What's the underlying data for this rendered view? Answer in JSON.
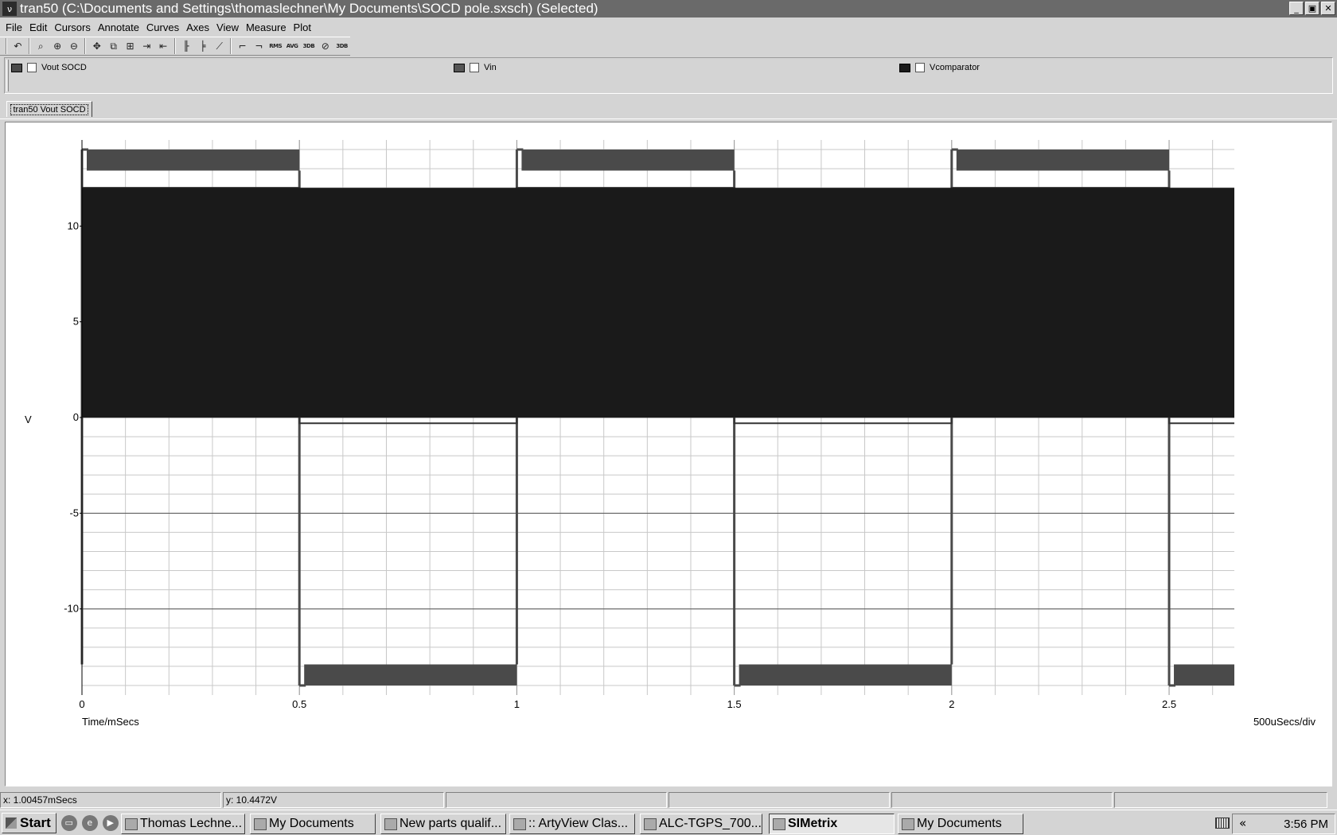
{
  "window": {
    "title": "tran50 (C:\\Documents and Settings\\thomaslechner\\My Documents\\SOCD pole.sxsch) (Selected)",
    "app_icon": "simetrix-icon",
    "minimize": "_",
    "maximize": "▣",
    "close": "✕"
  },
  "menu": [
    "File",
    "Edit",
    "Cursors",
    "Annotate",
    "Curves",
    "Axes",
    "View",
    "Measure",
    "Plot"
  ],
  "toolbar": {
    "groups": [
      [
        "undo-icon"
      ],
      [
        "zoom-full-icon",
        "zoom-in-icon",
        "zoom-out-icon"
      ],
      [
        "pan-icon",
        "zoom-box-icon",
        "abs-icon",
        "cursor-add-icon",
        "cursor-del-icon"
      ],
      [
        "new-grid-icon",
        "stack-grid-icon",
        "log-axis-icon"
      ],
      [
        "rise-icon",
        "fall-icon",
        "rms-icon",
        "avg-icon",
        "3db-high-icon",
        "3db-low-icon",
        "3db-band-icon"
      ]
    ],
    "labels": {
      "rms": "RMS",
      "avg": "AVG",
      "db1": "3DB",
      "db2": "3DB"
    }
  },
  "legend": [
    {
      "name": "Vout SOCD",
      "color": "#4a4a4a"
    },
    {
      "name": "Vin",
      "color": "#555555"
    },
    {
      "name": "Vcomparator",
      "color": "#1a1a1a"
    }
  ],
  "tab": {
    "label": "tran50 Vout SOCD"
  },
  "chart_data": {
    "type": "line",
    "xlabel": "Time/mSecs",
    "ylabel": "V",
    "x_scale_label": "500uSecs/div",
    "xlim": [
      0,
      2.65
    ],
    "ylim": [
      -14.5,
      14.5
    ],
    "x_ticks": [
      0,
      0.5,
      1,
      1.5,
      2,
      2.5
    ],
    "x_tick_labels": [
      "0",
      "0.5",
      "1",
      "1.5",
      "2",
      "2.5"
    ],
    "y_ticks": [
      -10,
      -5,
      0,
      5,
      10
    ],
    "y_tick_labels": [
      "-10",
      "-5",
      "0",
      "5",
      "10"
    ],
    "grid": true,
    "series": [
      {
        "name": "Vout SOCD",
        "color": "#4a4a4a",
        "high_band": [
          12.9,
          14.0
        ],
        "low_band": [
          -14.0,
          -12.9
        ],
        "transitions": [
          0,
          0.5,
          1,
          1.5,
          2,
          2.5
        ],
        "initial_state": "high"
      },
      {
        "name": "Vin",
        "color": "#333333",
        "high": 12.0,
        "low": -0.3,
        "transitions": [
          0,
          0.5,
          1,
          1.5,
          2,
          2.5
        ],
        "initial_state": "high"
      },
      {
        "name": "Vcomparator",
        "color": "#1a1a1a",
        "band": [
          0,
          12.0
        ],
        "x_range": [
          0,
          2.65
        ]
      }
    ]
  },
  "status": {
    "x": "x: 1.00457mSecs",
    "y": "y: 10.4472V"
  },
  "taskbar": {
    "start": "Start",
    "quick_launch": [
      "desktop-icon",
      "browser-icon",
      "media-icon"
    ],
    "buttons": [
      {
        "label": "Thomas Lechne...",
        "icon": "outlook-icon",
        "active": false
      },
      {
        "label": "My Documents",
        "icon": "folder-icon",
        "active": false
      },
      {
        "label": "New parts qualif...",
        "icon": "word-icon",
        "active": false
      },
      {
        "label": ":: ArtyView Clas...",
        "icon": "ie-icon",
        "active": false
      },
      {
        "label": "ALC-TGPS_700...",
        "icon": "doc-icon",
        "active": false
      },
      {
        "label": "SIMetrix",
        "icon": "simetrix-icon",
        "active": true
      },
      {
        "label": "My Documents",
        "icon": "folder-icon",
        "active": false
      }
    ],
    "tray_chevron": "«",
    "clock": "3:56 PM"
  }
}
